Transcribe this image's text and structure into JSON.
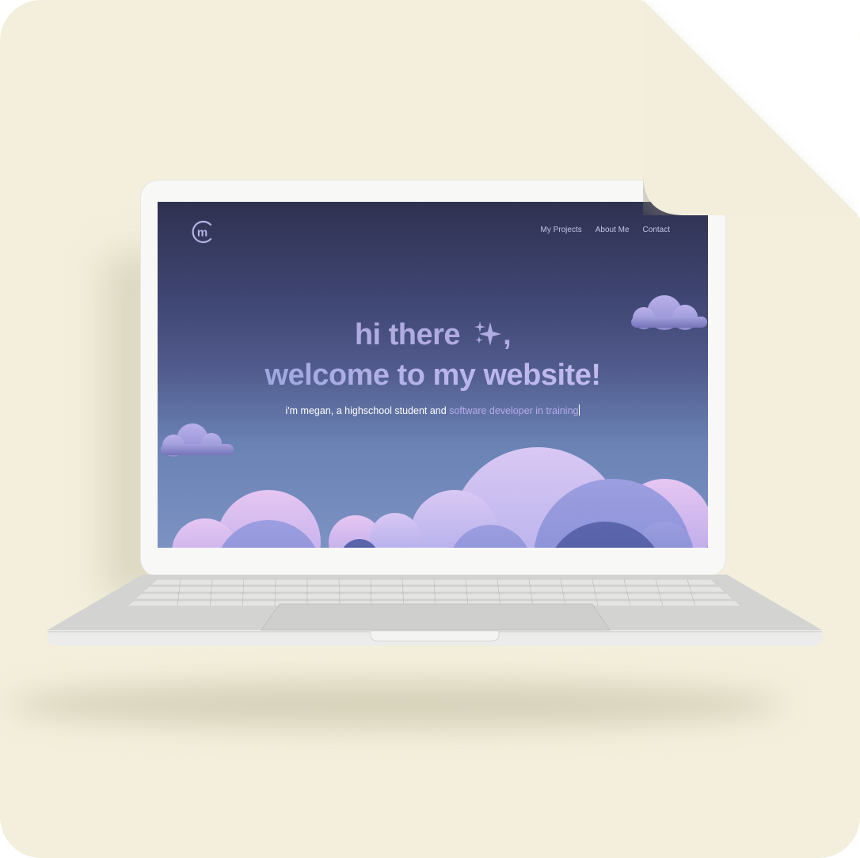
{
  "brand": {
    "logo_letter": "m"
  },
  "nav": {
    "items": [
      "My Projects",
      "About Me",
      "Contact"
    ]
  },
  "hero": {
    "line1": "hi there",
    "sparkle": "✨",
    "comma": ",",
    "line2": "welcome to my website!",
    "tagline_plain": "i'm megan, a highschool student and ",
    "tagline_highlight": "software developer in training"
  },
  "colors": {
    "page_bg": "#f3efdc",
    "screen_top": "#2f3150",
    "screen_bottom": "#7b92c3",
    "accent": "#b0abe2",
    "laptop_body": "#f8f8f7"
  }
}
